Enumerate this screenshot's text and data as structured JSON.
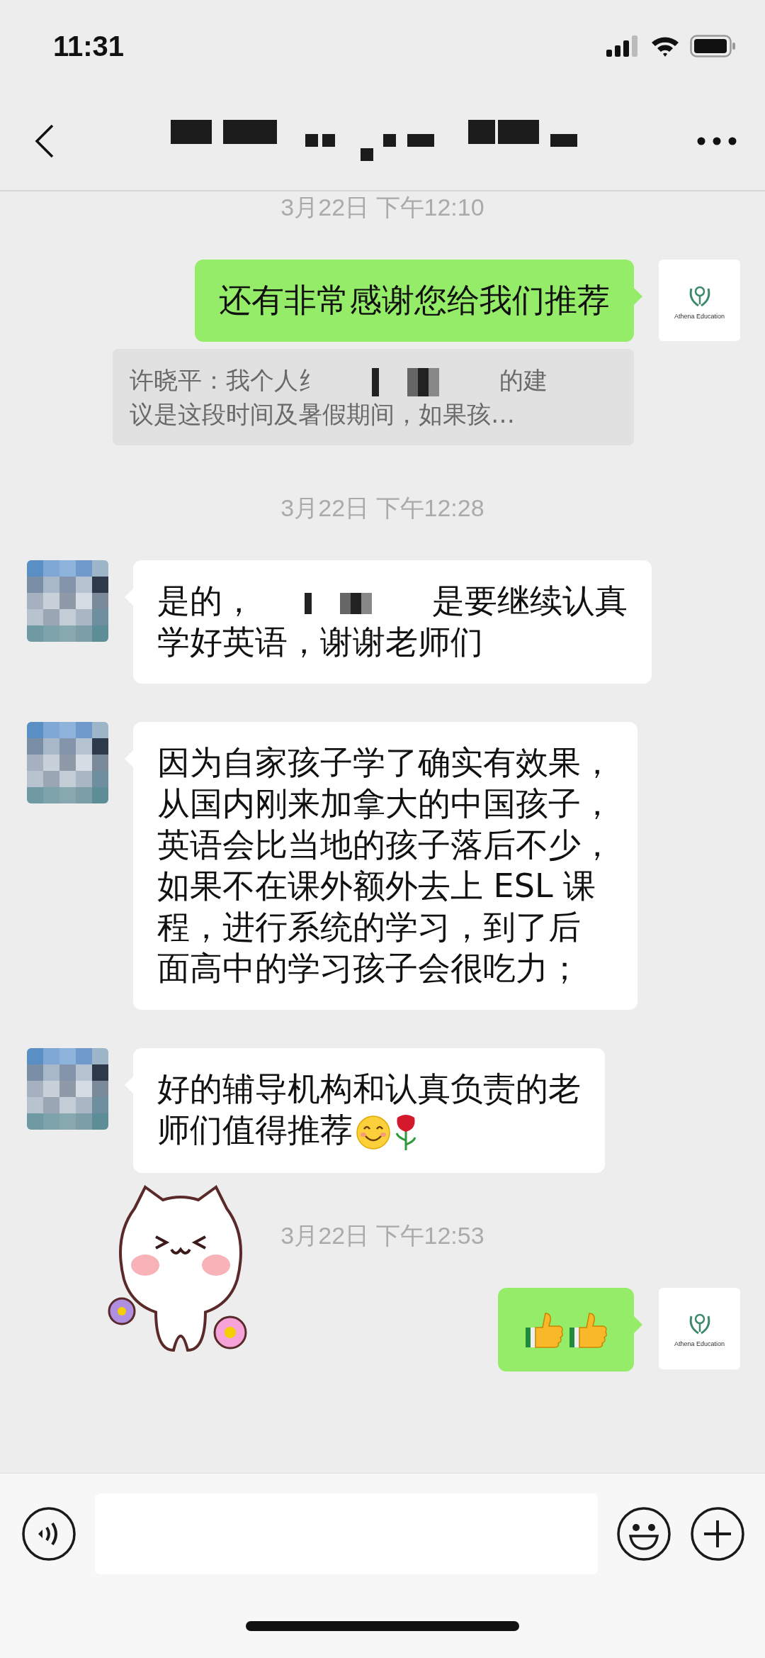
{
  "status_bar": {
    "time": "11:31"
  },
  "messages": [
    {
      "kind": "time",
      "text": "3月22日 下午12:10"
    },
    {
      "kind": "outgoing",
      "avatar_label": "Athena Education",
      "lines": [
        [
          {
            "kind": "text",
            "text": "还有非常感谢您给我们推荐"
          }
        ]
      ]
    },
    {
      "kind": "quote",
      "lines": [
        [
          {
            "kind": "text",
            "text": "许晓平：我个人纟"
          },
          {
            "kind": "redaction"
          },
          {
            "kind": "text",
            "text": "的建"
          }
        ],
        [
          {
            "kind": "text",
            "text": "议是这段时间及暑假期间，如果孩…"
          }
        ]
      ]
    },
    {
      "kind": "time",
      "text": "3月22日 下午12:28"
    },
    {
      "kind": "incoming",
      "lines": [
        [
          {
            "kind": "text",
            "text": "是的，"
          },
          {
            "kind": "redaction"
          },
          {
            "kind": "text",
            "text": "是要继续认真"
          }
        ],
        [
          {
            "kind": "text",
            "text": "学好英语，谢谢老师们"
          }
        ]
      ]
    },
    {
      "kind": "incoming",
      "lines": [
        [
          {
            "kind": "text",
            "text": "因为自家孩子学了确实有效果，"
          }
        ],
        [
          {
            "kind": "text",
            "text": "从国内刚来加拿大的中国孩子，"
          }
        ],
        [
          {
            "kind": "text",
            "text": "英语会比当地的孩子落后不少，"
          }
        ],
        [
          {
            "kind": "text",
            "text": "如果不在课外额外去上 ESL 课"
          }
        ],
        [
          {
            "kind": "text",
            "text": "程，进行系统的学习，到了后"
          }
        ],
        [
          {
            "kind": "text",
            "text": "面高中的学习孩子会很吃力；"
          }
        ]
      ]
    },
    {
      "kind": "incoming",
      "lines": [
        [
          {
            "kind": "text",
            "text": "好的辅导机构和认真负责的老"
          }
        ],
        [
          {
            "kind": "text",
            "text": "师们值得推荐"
          },
          {
            "kind": "smiley"
          },
          {
            "kind": "rose"
          }
        ]
      ]
    },
    {
      "kind": "sticker"
    },
    {
      "kind": "time",
      "text": "3月22日 下午12:53"
    },
    {
      "kind": "outgoing",
      "avatar_label": "Athena Education",
      "lines": [
        [
          {
            "kind": "thumbs"
          },
          {
            "kind": "thumbs"
          }
        ]
      ]
    }
  ]
}
